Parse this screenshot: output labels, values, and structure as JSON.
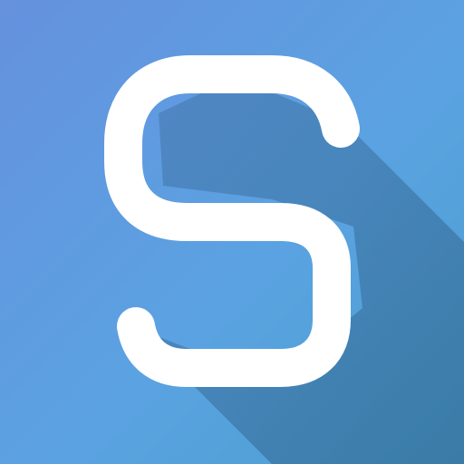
{
  "icon": {
    "name": "letter-s-app-icon",
    "glyph": "S",
    "colors": {
      "gradient_top_left": "#6591dd",
      "gradient_center": "#5ba2e2",
      "gradient_bottom_right": "#4aa0cf",
      "long_shadow": "#2d5d86",
      "letter": "#ffffff"
    }
  }
}
